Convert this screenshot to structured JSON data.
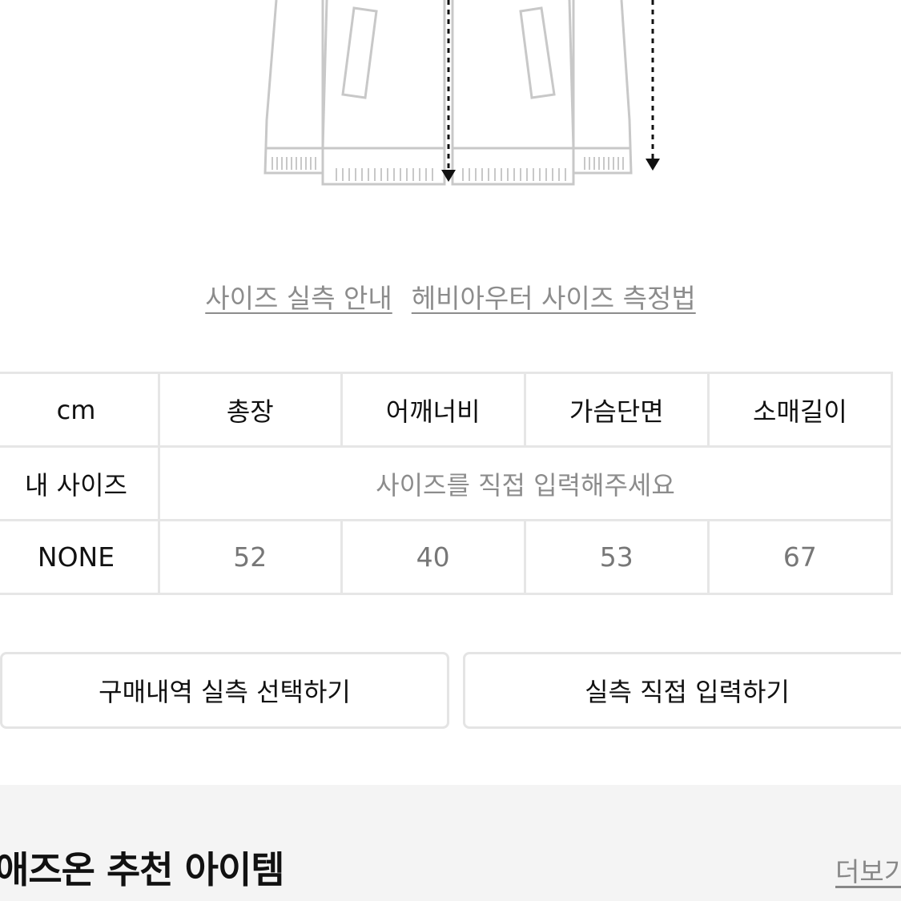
{
  "guide": {
    "links": [
      "사이즈 실측 안내",
      "헤비아우터 사이즈 측정법"
    ]
  },
  "size_table": {
    "header_label": "cm",
    "columns": [
      "총장",
      "어깨너비",
      "가슴단면",
      "소매길이"
    ],
    "my_size_label": "내 사이즈",
    "my_size_placeholder": "사이즈를 직접 입력해주세요",
    "rows": [
      {
        "label": "NONE",
        "values": [
          "52",
          "40",
          "53",
          "67"
        ]
      }
    ]
  },
  "buttons": {
    "history": "구매내역 실측 선택하기",
    "direct": "실측 직접 입력하기"
  },
  "recommend": {
    "title": "애즈온 추천 아이템",
    "more": "더보기"
  },
  "colors": {
    "border": "#e6e6e6",
    "muted_text": "#8c8c8c",
    "section_bg": "#f4f4f4"
  }
}
